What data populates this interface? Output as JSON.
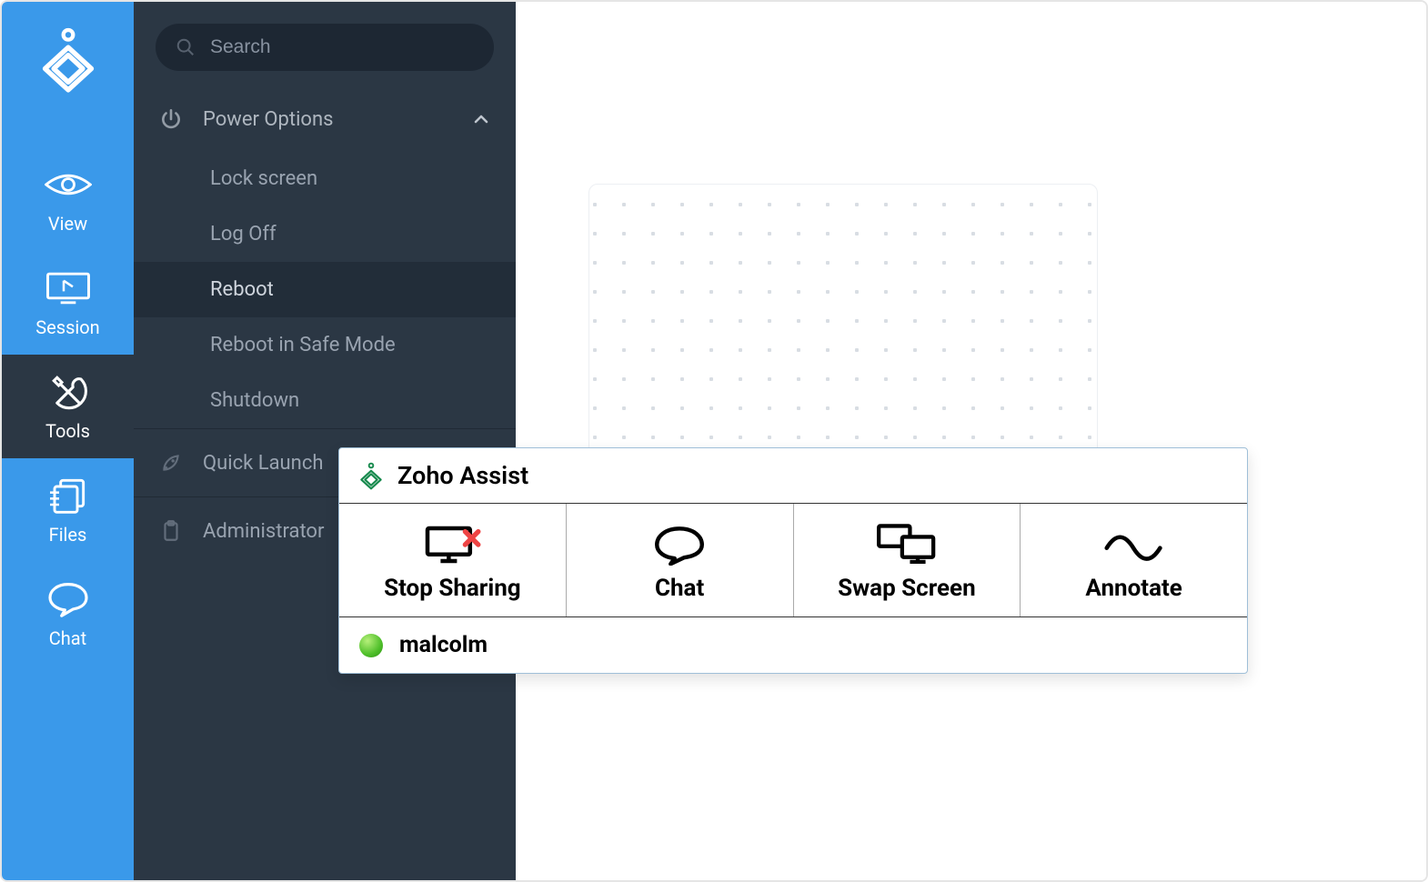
{
  "search": {
    "placeholder": "Search"
  },
  "rail": {
    "view": "View",
    "session": "Session",
    "tools": "Tools",
    "files": "Files",
    "chat": "Chat"
  },
  "panel": {
    "power": {
      "title": "Power Options",
      "lock": "Lock screen",
      "logoff": "Log Off",
      "reboot": "Reboot",
      "safemode": "Reboot in Safe Mode",
      "shutdown": "Shutdown"
    },
    "quick_launch": "Quick Launch",
    "administrator": "Administrator"
  },
  "assist": {
    "title": "Zoho Assist",
    "actions": {
      "stop_sharing": "Stop Sharing",
      "chat": "Chat",
      "swap_screen": "Swap Screen",
      "annotate": "Annotate"
    },
    "status_user": "malcolm"
  }
}
